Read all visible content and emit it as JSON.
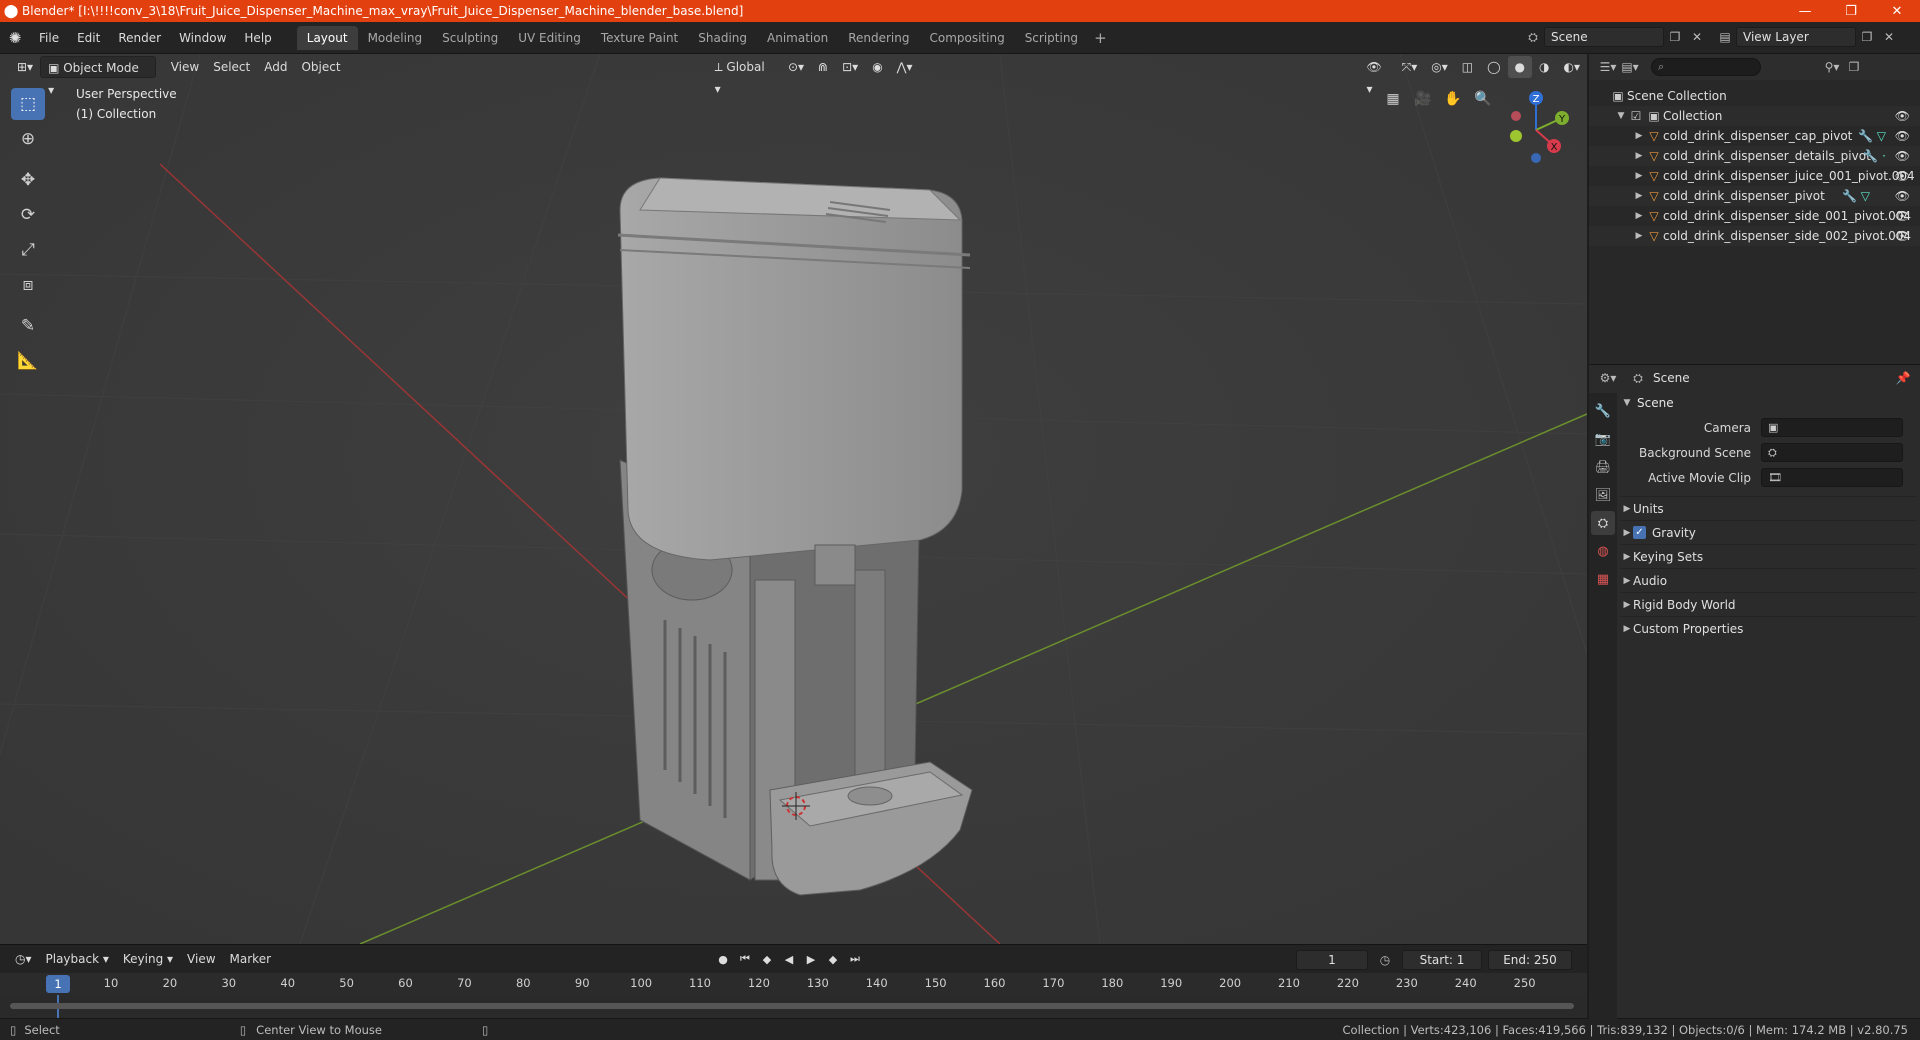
{
  "window": {
    "title": "Blender* [I:\\!!!!conv_3\\18\\Fruit_Juice_Dispenser_Machine_max_vray\\Fruit_Juice_Dispenser_Machine_blender_base.blend]",
    "minimize": "—",
    "maximize": "❐",
    "close": "✕"
  },
  "menus": [
    "File",
    "Edit",
    "Render",
    "Window",
    "Help"
  ],
  "workspaces": {
    "tabs": [
      "Layout",
      "Modeling",
      "Sculpting",
      "UV Editing",
      "Texture Paint",
      "Shading",
      "Animation",
      "Rendering",
      "Compositing",
      "Scripting"
    ],
    "active": "Layout",
    "add": "+"
  },
  "scene_selector": {
    "scene": "Scene",
    "view_layer": "View Layer"
  },
  "viewport": {
    "mode": "Object Mode",
    "menus": [
      "View",
      "Select",
      "Add",
      "Object"
    ],
    "orientation": "Global",
    "perspective": "User Perspective",
    "collection": "(1) Collection"
  },
  "gizmo": {
    "z": "Z",
    "y": "Y",
    "x": "X"
  },
  "outliner": {
    "root": "Scene Collection",
    "collection": "Collection",
    "objects": [
      {
        "name": "cold_drink_dispenser_cap_pivot",
        "mods": true
      },
      {
        "name": "cold_drink_dispenser_details_pivot",
        "mods": true
      },
      {
        "name": "cold_drink_dispenser_juice_001_pivot.004",
        "mods": false
      },
      {
        "name": "cold_drink_dispenser_pivot",
        "mods": true
      },
      {
        "name": "cold_drink_dispenser_side_001_pivot.004",
        "mods": false
      },
      {
        "name": "cold_drink_dispenser_side_002_pivot.004",
        "mods": false
      }
    ]
  },
  "properties": {
    "header": "Scene",
    "panel": "Scene",
    "fields": [
      {
        "label": "Camera",
        "value": ""
      },
      {
        "label": "Background Scene",
        "value": ""
      },
      {
        "label": "Active Movie Clip",
        "value": ""
      }
    ],
    "subpanels": [
      "Units",
      "Gravity",
      "Keying Sets",
      "Audio",
      "Rigid Body World",
      "Custom Properties"
    ],
    "gravity_enabled": true
  },
  "timeline": {
    "menus": [
      "Playback",
      "Keying",
      "View",
      "Marker"
    ],
    "current_frame": "1",
    "start_label": "Start:",
    "start": "1",
    "end_label": "End:",
    "end": "250",
    "ticks": [
      "10",
      "20",
      "30",
      "40",
      "50",
      "60",
      "70",
      "80",
      "90",
      "100",
      "110",
      "120",
      "130",
      "140",
      "150",
      "160",
      "170",
      "180",
      "190",
      "200",
      "210",
      "220",
      "230",
      "240",
      "250"
    ]
  },
  "statusbar": {
    "select": "Select",
    "center": "Center View to Mouse",
    "stats": "Collection | Verts:423,106 | Faces:419,566 | Tris:839,132 | Objects:0/6 | Mem: 174.2 MB | v2.80.75"
  }
}
